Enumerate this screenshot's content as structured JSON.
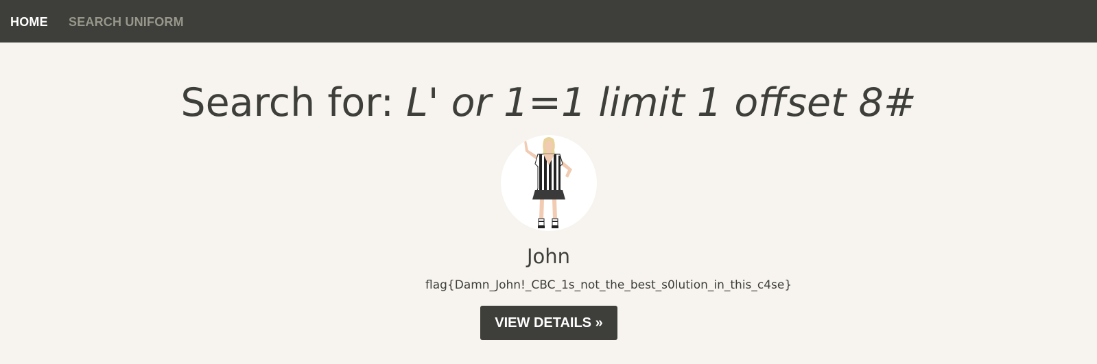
{
  "nav": {
    "home_label": "HOME",
    "search_label": "SEARCH UNIFORM"
  },
  "search": {
    "prefix": "Search for: ",
    "query": "L' or 1=1 limit 1 offset 8#"
  },
  "result": {
    "name": "John",
    "description": "flag{Damn_John!_CBC_1s_not_the_best_s0lution_in_this_c4se}",
    "button_label": "VIEW DETAILS »"
  },
  "colors": {
    "navbar": "#3e3f3a",
    "page_background": "#f7f4ef",
    "text": "#3e3f3a",
    "nav_inactive": "#98978b"
  }
}
